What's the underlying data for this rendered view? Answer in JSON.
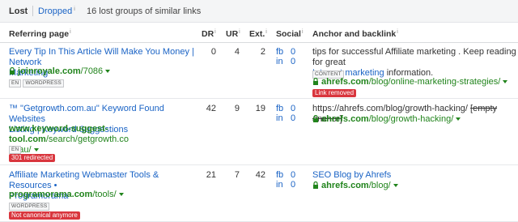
{
  "tabs": {
    "lost": "Lost",
    "dropped": "Dropped",
    "dropped_info": "i",
    "summary": "16 lost groups of similar links"
  },
  "columns": {
    "referring_page": "Referring page",
    "dr": "DR",
    "ur": "UR",
    "ext": "Ext.",
    "social": "Social",
    "anchor": "Anchor and backlink",
    "info": "i"
  },
  "rows": [
    {
      "title_line1": "Every Tip In This Article Will Make You Money | Network",
      "title_line2": "Marketing",
      "domain_bold": "joinroyale.com",
      "domain_path": "/7086",
      "tags": [
        "EN",
        "WORDPRESS"
      ],
      "dr": "0",
      "ur": "4",
      "ext": "2",
      "fb_label": "fb",
      "fb": "0",
      "in_label": "in",
      "in": "0",
      "anchor_line1": "tips for successful Affiliate marketing . Keep reading for great",
      "anchor_link": "Internet marketing",
      "anchor_after": " information.",
      "anchor_tag": "CONTENT",
      "backlink_bold": "ahrefs.com",
      "backlink_path": "/blog/online-marketing-strategies/",
      "status": "Link removed"
    },
    {
      "title_line1": "™ \"Getgrowth.com.au\" Keyword Found Websites",
      "title_line2": "Listing | Keyword Suggestions",
      "domain_bold": "www.keyword-suggest-tool.com",
      "domain_path": "/search/getgrowth.co",
      "domain_path2": "m.au/",
      "tags": [
        "EN"
      ],
      "dr": "42",
      "ur": "9",
      "ext": "19",
      "fb_label": "fb",
      "fb": "0",
      "in_label": "in",
      "in": "0",
      "anchor_url": "https://ahrefs.com/blog/growth-hacking/",
      "anchor_empty": "[empty anchor]",
      "backlink_bold": "ahrefs.com",
      "backlink_path": "/blog/growth-hacking/",
      "status": "301 redirected"
    },
    {
      "title_line1": "Affiliate Marketing Webmaster Tools & Resources •",
      "title_line2": "Programorama",
      "domain_bold": "programorama.com",
      "domain_path": "/tools/",
      "tags": [
        "WORDPRESS"
      ],
      "dr": "21",
      "ur": "7",
      "ext": "42",
      "fb_label": "fb",
      "fb": "0",
      "in_label": "in",
      "in": "0",
      "anchor_link": "SEO Blog by Ahrefs",
      "backlink_bold": "ahrefs.com",
      "backlink_path": "/blog/",
      "status": "Not canonical anymore"
    }
  ],
  "colors": {
    "link": "#1a63c5",
    "url_green": "#21841c",
    "badge_red": "#d9363e"
  },
  "icons": [
    "lock-icon",
    "caret-down-icon",
    "info-icon"
  ]
}
